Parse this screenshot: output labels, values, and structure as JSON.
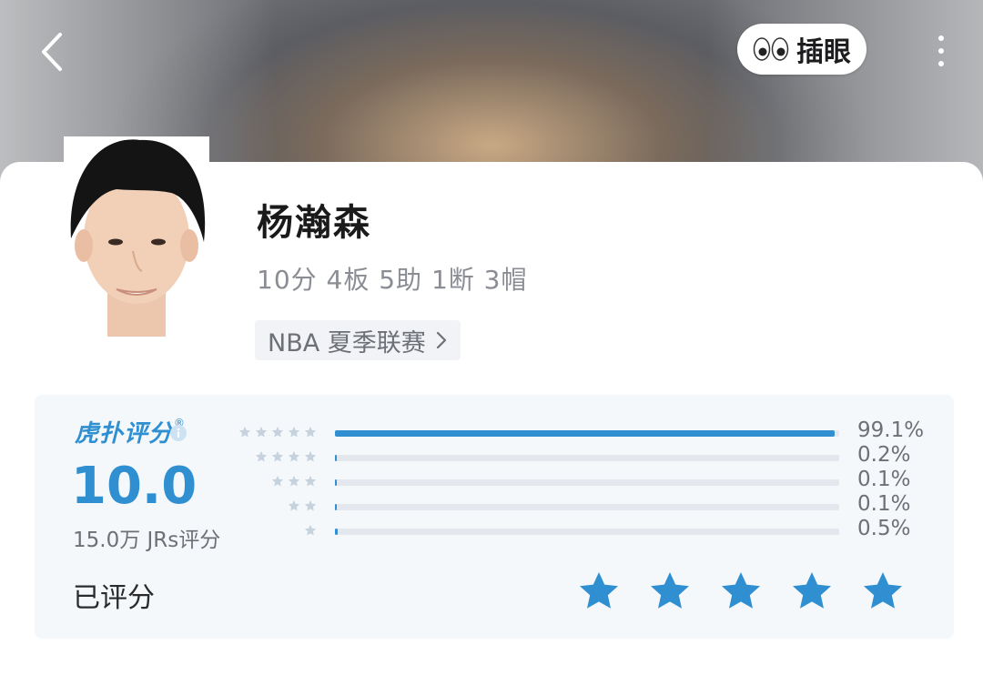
{
  "header": {
    "back_icon": "chevron-left-icon",
    "peek_button": {
      "icon": "eyes-icon",
      "label": "插眼"
    },
    "more_icon": "more-vertical-icon"
  },
  "player": {
    "name": "杨瀚森",
    "stats": "10分 4板 5助 1断 3帽",
    "league_label": "NBA 夏季联赛"
  },
  "rating": {
    "brand": "虎扑评分",
    "brand_mark": "®",
    "score": "10.0",
    "count_text": "15.0万 JRs评分",
    "accent_color": "#2f8fd1",
    "distribution": [
      {
        "stars": 5,
        "percent": 99.1,
        "label": "99.1%"
      },
      {
        "stars": 4,
        "percent": 0.2,
        "label": "0.2%"
      },
      {
        "stars": 3,
        "percent": 0.1,
        "label": "0.1%"
      },
      {
        "stars": 2,
        "percent": 0.1,
        "label": "0.1%"
      },
      {
        "stars": 1,
        "percent": 0.5,
        "label": "0.5%"
      }
    ],
    "user_status": "已评分",
    "user_rating": 5
  }
}
